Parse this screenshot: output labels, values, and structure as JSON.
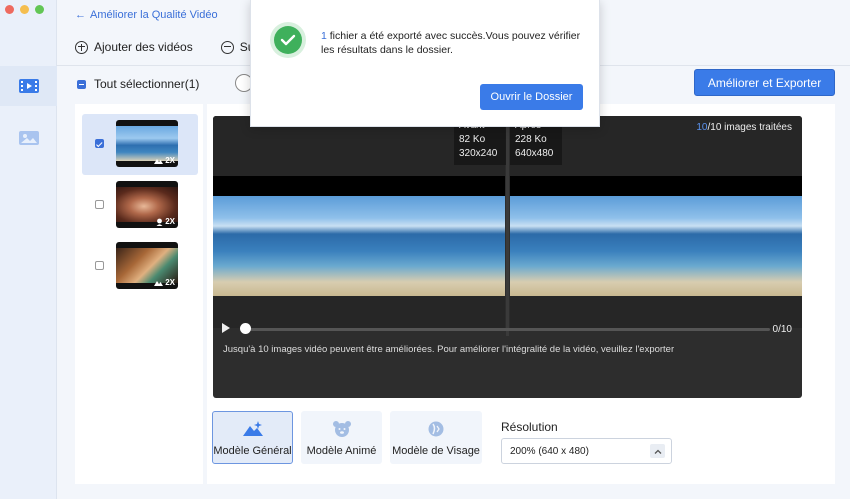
{
  "window": {
    "traffic_colors": [
      "#ee6a5f",
      "#f5be4f",
      "#62c655"
    ]
  },
  "header": {
    "back_label": "Améliorer la Qualité Vidéo"
  },
  "toolbar": {
    "add_label": "Ajouter des vidéos",
    "delete_label": "Supp"
  },
  "selection": {
    "select_all_label": "Tout sélectionner(1)"
  },
  "actions": {
    "export_label": "Améliorer et Exporter"
  },
  "thumbnails": [
    {
      "badge": "2X",
      "selected": true
    },
    {
      "badge": "2X",
      "selected": false
    },
    {
      "badge": "2X",
      "selected": false
    }
  ],
  "preview": {
    "before": {
      "label": "Avant",
      "size": "82 Ko",
      "dims": "320x240"
    },
    "after": {
      "label": "Après",
      "size": "228 Ko",
      "dims": "640x480"
    },
    "processed_count": "10",
    "processed_suffix": "/10 images traitées",
    "frame_counter": "0/10",
    "notice": "Jusqu'à 10 images vidéo peuvent être améliorées. Pour améliorer l'intégralité de la vidéo, veuillez l'exporter"
  },
  "models": {
    "general": "Modèle Général",
    "anime": "Modèle Animé",
    "face": "Modèle de Visage"
  },
  "resolution": {
    "label": "Résolution",
    "value": "200% (640 x 480)"
  },
  "popup": {
    "count": "1",
    "message": " fichier a été exporté avec succès.Vous pouvez vérifier les résultats dans le dossier.",
    "button_label": "Ouvrir le Dossier"
  },
  "colors": {
    "accent": "#3a7be8",
    "success": "#3fb05c"
  }
}
